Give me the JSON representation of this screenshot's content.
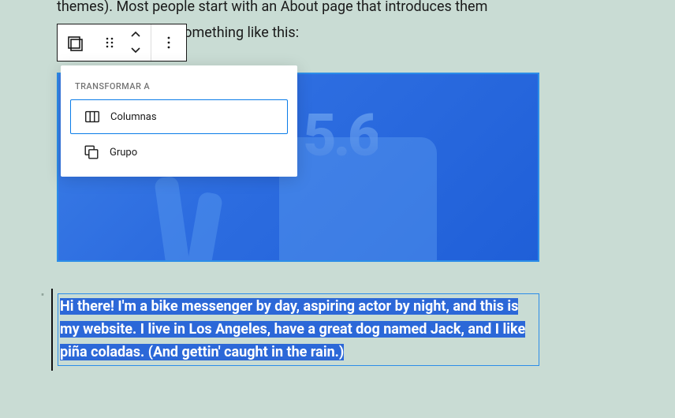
{
  "body_text": {
    "line1": "themes). Most people start with an About page that introduces them",
    "line2": "sitors. It might say something like this:"
  },
  "toolbar": {
    "block_type_icon": "cover-icon",
    "drag_icon": "drag-handle-icon",
    "move_up_icon": "chevron-up-icon",
    "move_down_icon": "chevron-down-icon",
    "options_icon": "more-options-icon"
  },
  "transform_menu": {
    "header": "TRANSFORMAR A",
    "items": [
      {
        "icon": "columns-icon",
        "label": "Columnas",
        "active": true
      },
      {
        "icon": "group-icon",
        "label": "Grupo",
        "active": false
      }
    ]
  },
  "cover": {
    "version_number": "5.6"
  },
  "quote": {
    "text": "Hi there! I'm a bike messenger by day, aspiring actor by night, and this is my website. I live in Los Angeles, have a great dog named Jack, and I like piña coladas. (And gettin' caught in the rain.)"
  }
}
